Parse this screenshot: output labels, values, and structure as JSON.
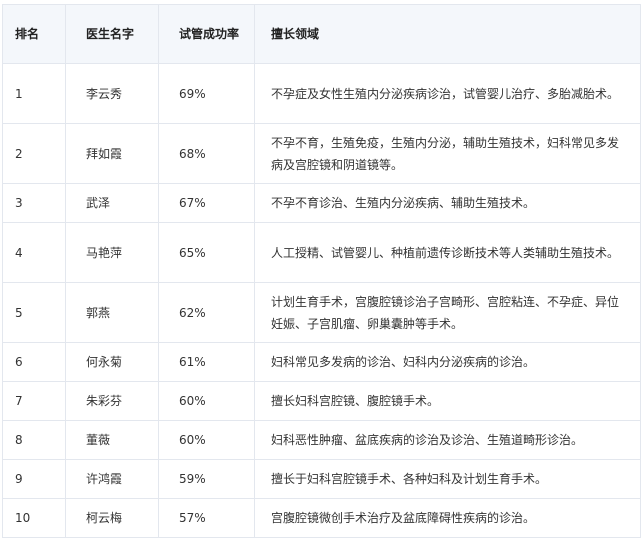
{
  "table": {
    "headers": {
      "rank": "排名",
      "name": "医生名字",
      "rate": "试管成功率",
      "specialty": "擅长领域"
    },
    "rows": [
      {
        "rank": "1",
        "name": "李云秀",
        "rate": "69%",
        "specialty": "不孕症及女性生殖内分泌疾病诊治，试管婴儿治疗、多胎减胎术。"
      },
      {
        "rank": "2",
        "name": "拜如霞",
        "rate": "68%",
        "specialty": "不孕不育，生殖免疫，生殖内分泌，辅助生殖技术，妇科常见多发病及宫腔镜和阴道镜等。"
      },
      {
        "rank": "3",
        "name": "武泽",
        "rate": "67%",
        "specialty": "不孕不育诊治、生殖内分泌疾病、辅助生殖技术。"
      },
      {
        "rank": "4",
        "name": "马艳萍",
        "rate": "65%",
        "specialty": "人工授精、试管婴儿、种植前遗传诊断技术等人类辅助生殖技术。"
      },
      {
        "rank": "5",
        "name": "郭燕",
        "rate": "62%",
        "specialty": "计划生育手术，宫腹腔镜诊治子宫畸形、宫腔粘连、不孕症、异位妊娠、子宫肌瘤、卵巢囊肿等手术。"
      },
      {
        "rank": "6",
        "name": "何永菊",
        "rate": "61%",
        "specialty": "妇科常见多发病的诊治、妇科内分泌疾病的诊治。"
      },
      {
        "rank": "7",
        "name": "朱彩芬",
        "rate": "60%",
        "specialty": "擅长妇科宫腔镜、腹腔镜手术。"
      },
      {
        "rank": "8",
        "name": "董薇",
        "rate": "60%",
        "specialty": "妇科恶性肿瘤、盆底疾病的诊治及诊治、生殖道畸形诊治。"
      },
      {
        "rank": "9",
        "name": "许鸿霞",
        "rate": "59%",
        "specialty": "擅长于妇科宫腔镜手术、各种妇科及计划生育手术。"
      },
      {
        "rank": "10",
        "name": "柯云梅",
        "rate": "57%",
        "specialty": "宫腹腔镜微创手术治疗及盆底障碍性疾病的诊治。"
      }
    ]
  }
}
